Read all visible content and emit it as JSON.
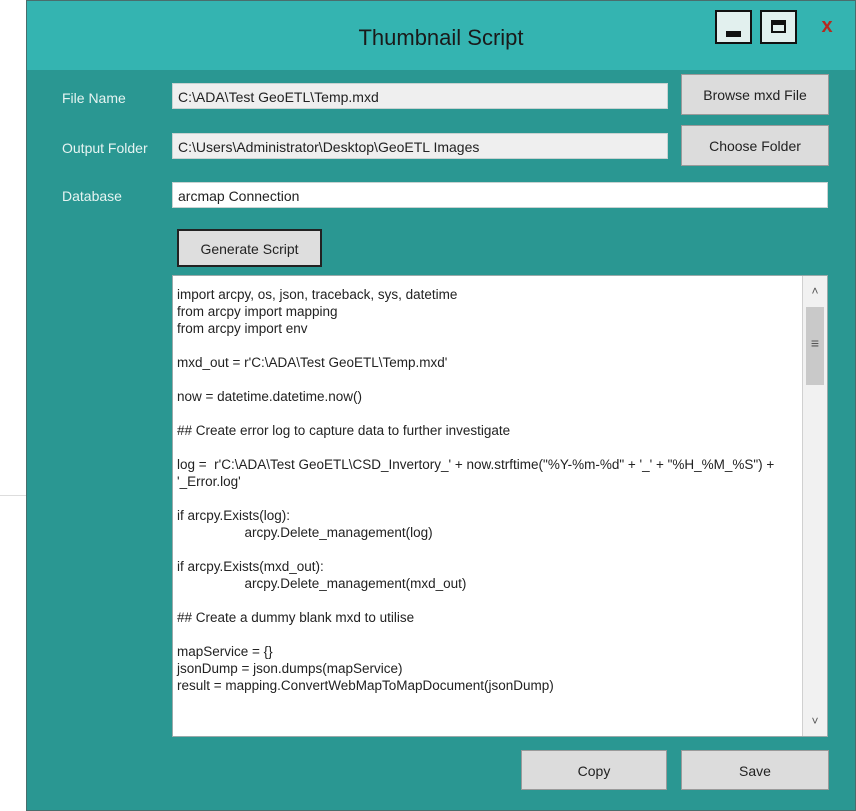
{
  "window": {
    "title": "Thumbnail Script",
    "controls": {
      "minimize": "–",
      "maximize": "□",
      "close": "x"
    }
  },
  "form": {
    "file_name_label": "File Name",
    "file_name_value": "C:\\ADA\\Test GeoETL\\Temp.mxd",
    "browse_label": "Browse mxd File",
    "output_folder_label": "Output Folder",
    "output_folder_value": "C:\\Users\\Administrator\\Desktop\\GeoETL Images",
    "choose_folder_label": "Choose Folder",
    "database_label": "Database",
    "database_value": "arcmap Connection",
    "generate_label": "Generate Script"
  },
  "script_lines": [
    "import arcpy, os, json, traceback, sys, datetime",
    "from arcpy import mapping",
    "from arcpy import env",
    "",
    "mxd_out = r'C:\\ADA\\Test GeoETL\\Temp.mxd'",
    "",
    "now = datetime.datetime.now()",
    "",
    "## Create error log to capture data to further investigate",
    "",
    "log =  r'C:\\ADA\\Test GeoETL\\CSD_Invertory_' + now.strftime(\"%Y-%m-%d\" + '_' + \"%H_%M_%S\") + '_Error.log'",
    "",
    "if arcpy.Exists(log):",
    "                  arcpy.Delete_management(log)",
    "",
    "if arcpy.Exists(mxd_out):",
    "                  arcpy.Delete_management(mxd_out)",
    "",
    "## Create a dummy blank mxd to utilise",
    "",
    "mapService = {}",
    "jsonDump = json.dumps(mapService)",
    "result = mapping.ConvertWebMapToMapDocument(jsonDump)"
  ],
  "scrollbar": {
    "up": "˄",
    "down": "˅",
    "grip": "≡"
  },
  "actions": {
    "copy_label": "Copy",
    "save_label": "Save"
  },
  "colors": {
    "window_bg": "#2a9792",
    "titlebar": "#34b4b1",
    "close": "#b52a1f"
  }
}
